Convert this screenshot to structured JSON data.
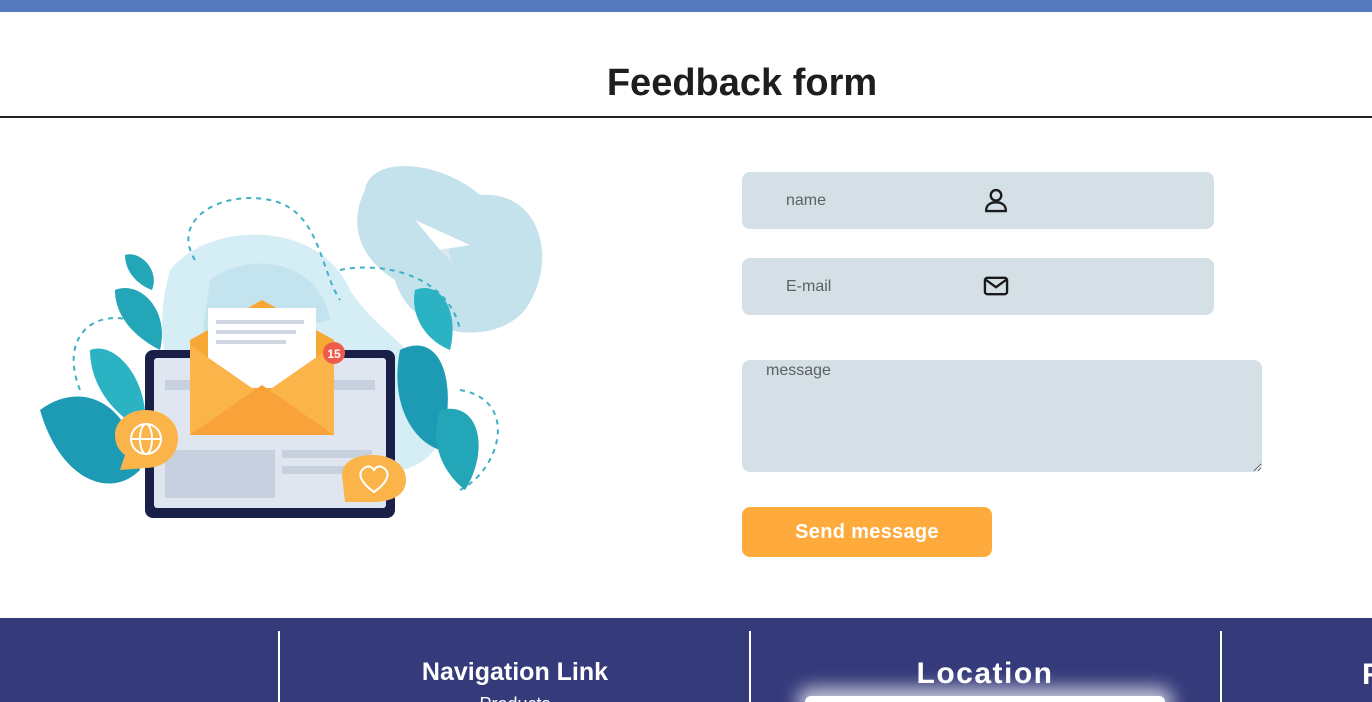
{
  "header": {
    "title": "Feedback form"
  },
  "form": {
    "name_placeholder": "name",
    "email_placeholder": "E-mail",
    "message_placeholder": "message",
    "submit_label": "Send message"
  },
  "illustration": {
    "badge_count": "15"
  },
  "footer": {
    "nav_title": "Navigation Link",
    "nav_first_item": "Products",
    "location_title": "Location",
    "fourth_title_partial": "F"
  },
  "colors": {
    "top_bar": "#5679bd",
    "input_bg": "#d4dfe6",
    "button": "#ffaa3c",
    "footer_bg": "#343a7a"
  }
}
